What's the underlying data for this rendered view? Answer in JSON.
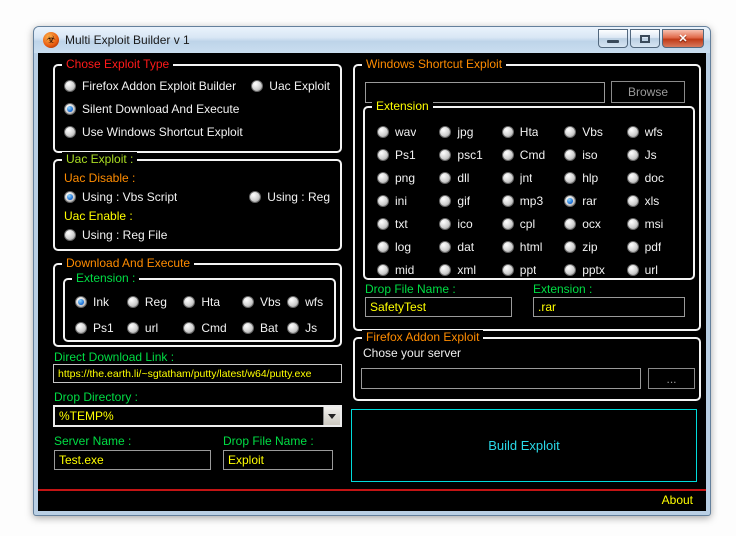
{
  "window": {
    "title": "Multi Exploit Builder v 1",
    "icon_glyph": "☣"
  },
  "exploit_type": {
    "title": "Chose Exploit Type",
    "options": [
      {
        "label": "Firefox Addon Exploit Builder",
        "selected": false
      },
      {
        "label": "Uac Exploit",
        "selected": false
      },
      {
        "label": "Silent Download And Execute",
        "selected": true
      },
      {
        "label": "Use Windows Shortcut Exploit",
        "selected": false
      }
    ]
  },
  "uac": {
    "title": "Uac Exploit :",
    "disable_label": "Uac Disable :",
    "disable_options": [
      {
        "label": "Using : Vbs Script",
        "selected": true
      },
      {
        "label": "Using : Reg",
        "selected": false
      }
    ],
    "enable_label": "Uac Enable :",
    "enable_option": {
      "label": "Using : Reg File",
      "selected": false
    }
  },
  "dne": {
    "title": "Download And Execute",
    "extension": {
      "title": "Extension :",
      "options": [
        {
          "label": "Ink",
          "selected": true
        },
        {
          "label": "Reg",
          "selected": false
        },
        {
          "label": "Hta",
          "selected": false
        },
        {
          "label": "Vbs",
          "selected": false
        },
        {
          "label": "wfs",
          "selected": false
        },
        {
          "label": "Ps1",
          "selected": false
        },
        {
          "label": "url",
          "selected": false
        },
        {
          "label": "Cmd",
          "selected": false
        },
        {
          "label": "Bat",
          "selected": false
        },
        {
          "label": "Js",
          "selected": false
        }
      ]
    },
    "direct_link": {
      "label": "Direct Download Link :",
      "value": "https://the.earth.li/~sgtatham/putty/latest/w64/putty.exe"
    },
    "drop_directory": {
      "label": "Drop Directory :",
      "value": "%TEMP%"
    },
    "server_name": {
      "label": "Server Name :",
      "value": "Test.exe"
    },
    "drop_file": {
      "label": "Drop File Name :",
      "value": "Exploit"
    }
  },
  "shortcut": {
    "title": "Windows Shortcut Exploit",
    "file_value": "",
    "browse_label": "Browse",
    "extension_grid": {
      "title": "Extension",
      "options": [
        {
          "label": "wav",
          "selected": false
        },
        {
          "label": "jpg",
          "selected": false
        },
        {
          "label": "Hta",
          "selected": false
        },
        {
          "label": "Vbs",
          "selected": false
        },
        {
          "label": "wfs",
          "selected": false
        },
        {
          "label": "Ps1",
          "selected": false
        },
        {
          "label": "psc1",
          "selected": false
        },
        {
          "label": "Cmd",
          "selected": false
        },
        {
          "label": "iso",
          "selected": false
        },
        {
          "label": "Js",
          "selected": false
        },
        {
          "label": "png",
          "selected": false
        },
        {
          "label": "dll",
          "selected": false
        },
        {
          "label": "jnt",
          "selected": false
        },
        {
          "label": "hlp",
          "selected": false
        },
        {
          "label": "doc",
          "selected": false
        },
        {
          "label": "ini",
          "selected": false
        },
        {
          "label": "gif",
          "selected": false
        },
        {
          "label": "mp3",
          "selected": false
        },
        {
          "label": "rar",
          "selected": true
        },
        {
          "label": "xls",
          "selected": false
        },
        {
          "label": "txt",
          "selected": false
        },
        {
          "label": "ico",
          "selected": false
        },
        {
          "label": "cpl",
          "selected": false
        },
        {
          "label": "ocx",
          "selected": false
        },
        {
          "label": "msi",
          "selected": false
        },
        {
          "label": "log",
          "selected": false
        },
        {
          "label": "dat",
          "selected": false
        },
        {
          "label": "html",
          "selected": false
        },
        {
          "label": "zip",
          "selected": false
        },
        {
          "label": "pdf",
          "selected": false
        },
        {
          "label": "mid",
          "selected": false
        },
        {
          "label": "xml",
          "selected": false
        },
        {
          "label": "ppt",
          "selected": false
        },
        {
          "label": "pptx",
          "selected": false
        },
        {
          "label": "url",
          "selected": false
        }
      ]
    },
    "drop_file": {
      "label": "Drop File Name :",
      "value": "SafetyTest"
    },
    "extension_field": {
      "label": "Extension :",
      "value": ".rar"
    }
  },
  "firefox": {
    "title": "Firefox Addon Exploit",
    "server_label": "Chose your server",
    "server_value": "",
    "browse_label": "..."
  },
  "build_label": "Build Exploit",
  "footer": {
    "about_label": "About"
  },
  "colors": {
    "title_red": "#ff1a1a",
    "title_orange": "#ff8c00",
    "title_yellow": "#ffff00",
    "title_greenyellow": "#aadd22",
    "label_green": "#00dd44",
    "input_text_yellow": "#ffff00",
    "build_cyan": "#00dcdc",
    "separator_red": "#c41414",
    "radio_selected_blue": "#0a5fd0",
    "client_background": "#000000",
    "frame_blue": "#b9cfe4"
  }
}
